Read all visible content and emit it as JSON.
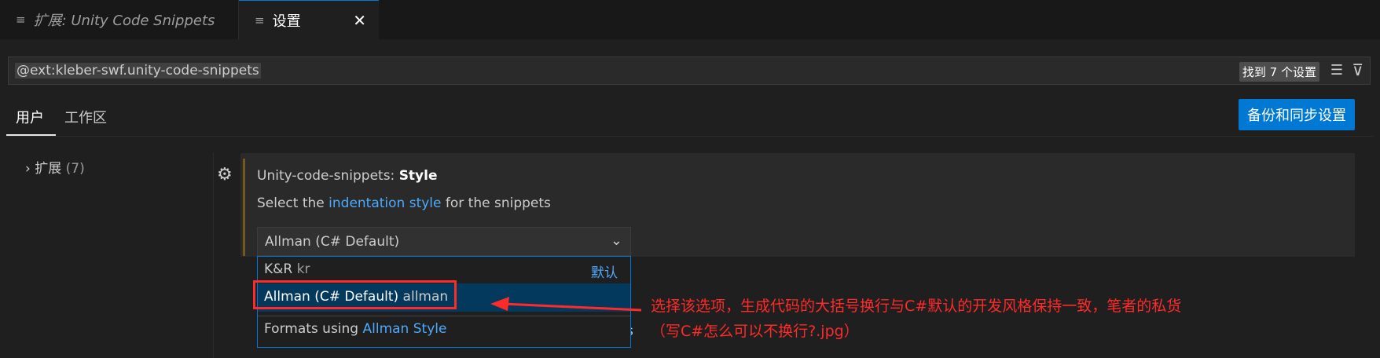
{
  "tabs": [
    {
      "icon": "preview-icon",
      "label": "扩展: Unity Code Snippets"
    },
    {
      "icon": "settings-file-icon",
      "label": "设置",
      "close": "✕"
    }
  ],
  "search": {
    "value": "@ext:kleber-swf.unity-code-snippets",
    "result_badge": "找到 7 个设置"
  },
  "scope_tabs": [
    "用户",
    "工作区"
  ],
  "sync_button": "备份和同步设置",
  "tree": {
    "label": "扩展",
    "count": "(7)"
  },
  "setting": {
    "prefix": "Unity-code-snippets: ",
    "name": "Style",
    "desc_before": "Select the ",
    "desc_link": "indentation style",
    "desc_after": " for the snippets",
    "selected_value": "Allman (C# Default)"
  },
  "dropdown": {
    "options": [
      {
        "label": "K&R",
        "value": "kr",
        "tag": "默认"
      },
      {
        "label": "Allman (C# Default)",
        "value": "allman"
      }
    ],
    "description_prefix": "Formats using ",
    "description_link": "Allman Style",
    "partially_hidden_text": "s"
  },
  "annotation": {
    "line1": "选择该选项，生成代码的大括号换行与C#默认的开发风格保持一致，笔者的私货",
    "line2": "（写C#怎么可以不换行?.jpg）",
    "color": "#ff2a2a"
  },
  "colors": {
    "accent": "#0078d4",
    "link": "#4daafc",
    "selection": "#04395e",
    "modified_bar": "#73591c"
  }
}
